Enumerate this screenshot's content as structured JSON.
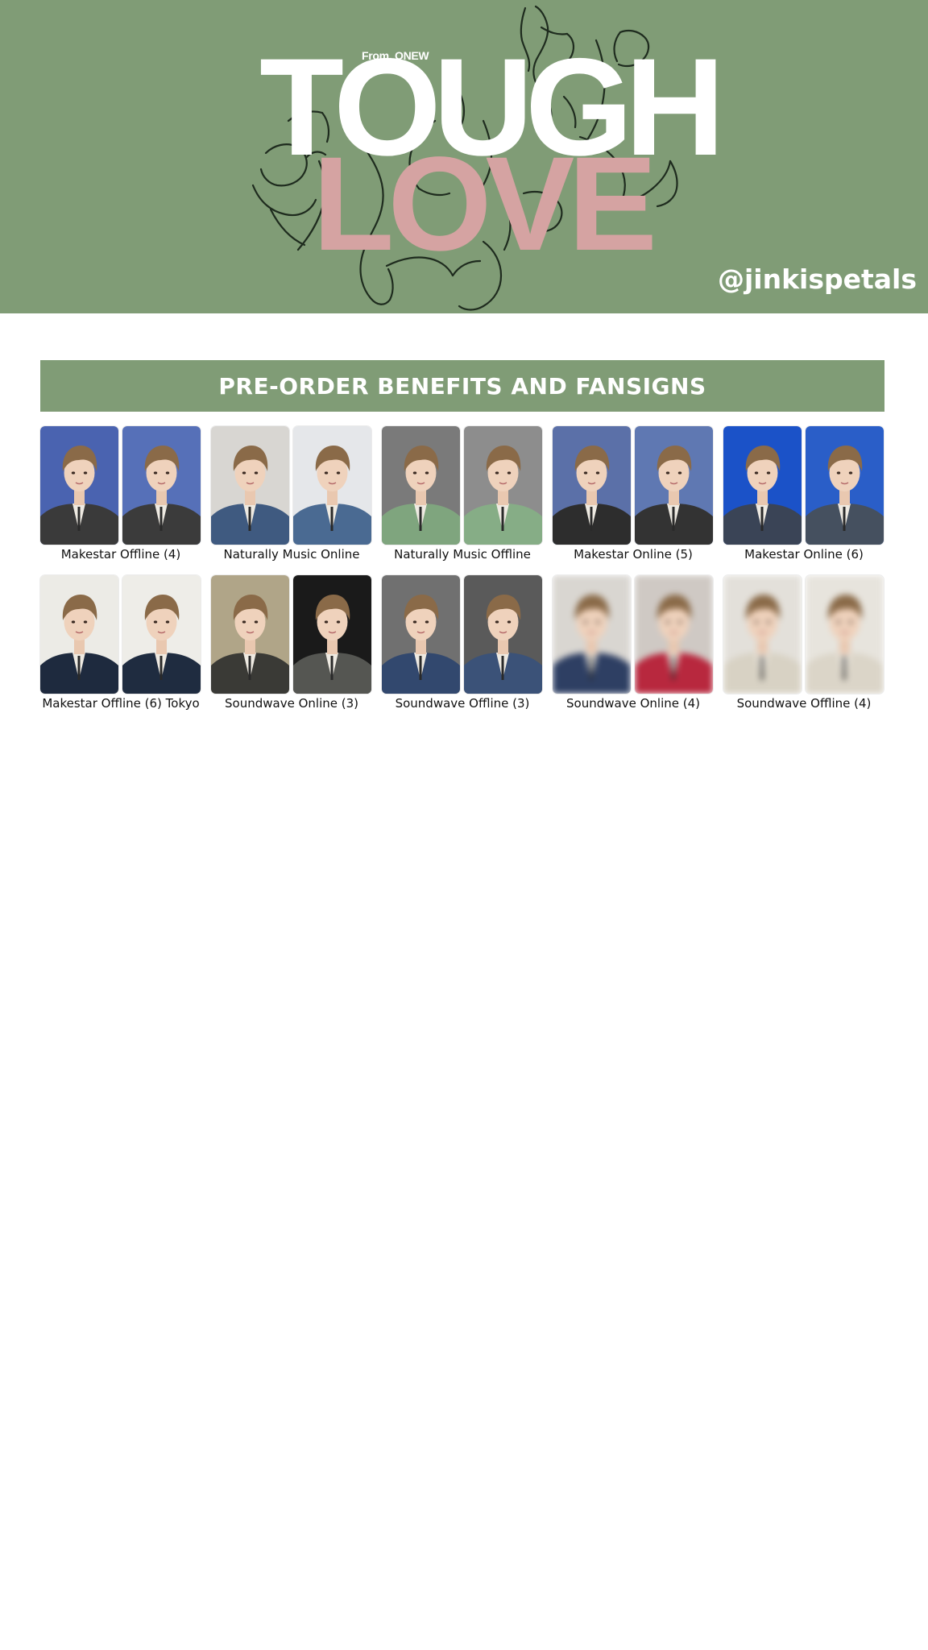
{
  "banner": {
    "from_label": "From. ONEW",
    "title_line1": "TOUGH",
    "title_line2": "LOVE",
    "handle": "@jinkispetals",
    "bg_color": "#809c76",
    "love_color": "#d5a3a2"
  },
  "section": {
    "title": "PRE-ORDER BENEFITS AND FANSIGNS"
  },
  "benefits": [
    {
      "label": "Makestar Offline (4)",
      "bg": [
        "#4a63b0",
        "#5670b8"
      ],
      "top": [
        "#3a3a3a",
        "#3b3b3b"
      ],
      "blur": false
    },
    {
      "label": "Naturally Music Online",
      "bg": [
        "#d8d6d2",
        "#e5e7ea"
      ],
      "top": [
        "#3f5a80",
        "#4a6a92"
      ],
      "blur": false
    },
    {
      "label": "Naturally Music Offline",
      "bg": [
        "#7a7a7a",
        "#8d8d8d"
      ],
      "top": [
        "#7fa57e",
        "#86ad86"
      ],
      "blur": false
    },
    {
      "label": "Makestar Online (5)",
      "bg": [
        "#5b70a8",
        "#5f78b2"
      ],
      "top": [
        "#2d2d2d",
        "#333333"
      ],
      "blur": false
    },
    {
      "label": "Makestar Online (6)",
      "bg": [
        "#1b52c8",
        "#2a5ec8"
      ],
      "top": [
        "#3a4456",
        "#45505f"
      ],
      "blur": false
    },
    {
      "label": "Makestar Offline (6) Tokyo",
      "bg": [
        "#ecebe6",
        "#eeede8"
      ],
      "top": [
        "#1e2a3e",
        "#1f2c40"
      ],
      "blur": false
    },
    {
      "label": "Soundwave Online (3)",
      "bg": [
        "#b0a588",
        "#1a1a1a"
      ],
      "top": [
        "#3a3a36",
        "#555652"
      ],
      "blur": false
    },
    {
      "label": "Soundwave Offline (3)",
      "bg": [
        "#707070",
        "#5a5a5a"
      ],
      "top": [
        "#32486e",
        "#3b5278"
      ],
      "blur": false
    },
    {
      "label": "Soundwave Online (4)",
      "bg": [
        "#d9d6d1",
        "#cfc9c4"
      ],
      "top": [
        "#2e3f63",
        "#b8283e"
      ],
      "blur": true
    },
    {
      "label": "Soundwave Offline (4)",
      "bg": [
        "#e3e0da",
        "#e7e4dd"
      ],
      "top": [
        "#d8d2c4",
        "#dbd5c8"
      ],
      "blur": true
    }
  ]
}
